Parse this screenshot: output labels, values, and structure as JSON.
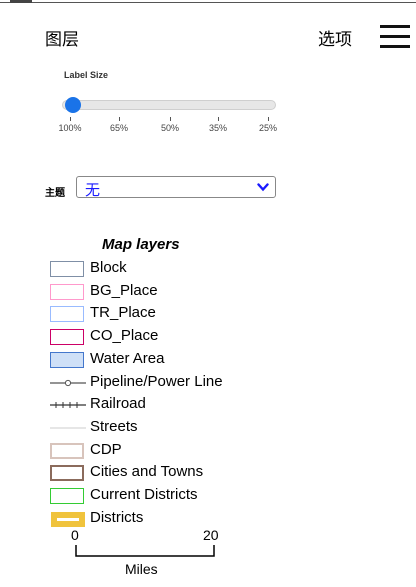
{
  "header": {
    "title": "图层",
    "options_label": "选项",
    "menu_icon": "hamburger-menu-icon"
  },
  "label_size": {
    "label": "Label Size",
    "ticks": [
      "100%",
      "65%",
      "50%",
      "35%",
      "25%"
    ],
    "selected_index": 0,
    "selected_value": "100%",
    "accent": "#1a73e8"
  },
  "theme": {
    "label": "主题",
    "value": "无",
    "value_color": "#1a1aff"
  },
  "legend": {
    "title": "Map layers",
    "items": [
      {
        "label": "Block",
        "swatch": "box",
        "stroke": "#7f8fa6",
        "fill": "#ffffff"
      },
      {
        "label": "BG_Place",
        "swatch": "box",
        "stroke": "#ff99cc",
        "fill": "#ffffff"
      },
      {
        "label": "TR_Place",
        "swatch": "box",
        "stroke": "#99bbff",
        "fill": "#ffffff"
      },
      {
        "label": "CO_Place",
        "swatch": "box",
        "stroke": "#cc0066",
        "fill": "#ffffff"
      },
      {
        "label": "Water Area",
        "swatch": "box",
        "stroke": "#4477cc",
        "fill": "#cfe0f7"
      },
      {
        "label": "Pipeline/Power Line",
        "swatch": "pipeline",
        "stroke": "#555555",
        "fill": ""
      },
      {
        "label": "Railroad",
        "swatch": "railroad",
        "stroke": "#333333",
        "fill": ""
      },
      {
        "label": "Streets",
        "swatch": "line",
        "stroke": "#cccccc",
        "fill": ""
      },
      {
        "label": "CDP",
        "swatch": "box",
        "stroke": "#d8c4bc",
        "fill": "#ffffff"
      },
      {
        "label": "Cities and Towns",
        "swatch": "box",
        "stroke": "#8b6b5c",
        "fill": "#ffffff"
      },
      {
        "label": "Current Districts",
        "swatch": "box",
        "stroke": "#33cc33",
        "fill": "#ffffff"
      },
      {
        "label": "Districts",
        "swatch": "district",
        "stroke": "#f0c33c",
        "fill": "#ffffff"
      }
    ]
  },
  "scale": {
    "start": "0",
    "end": "20",
    "unit": "Miles"
  }
}
